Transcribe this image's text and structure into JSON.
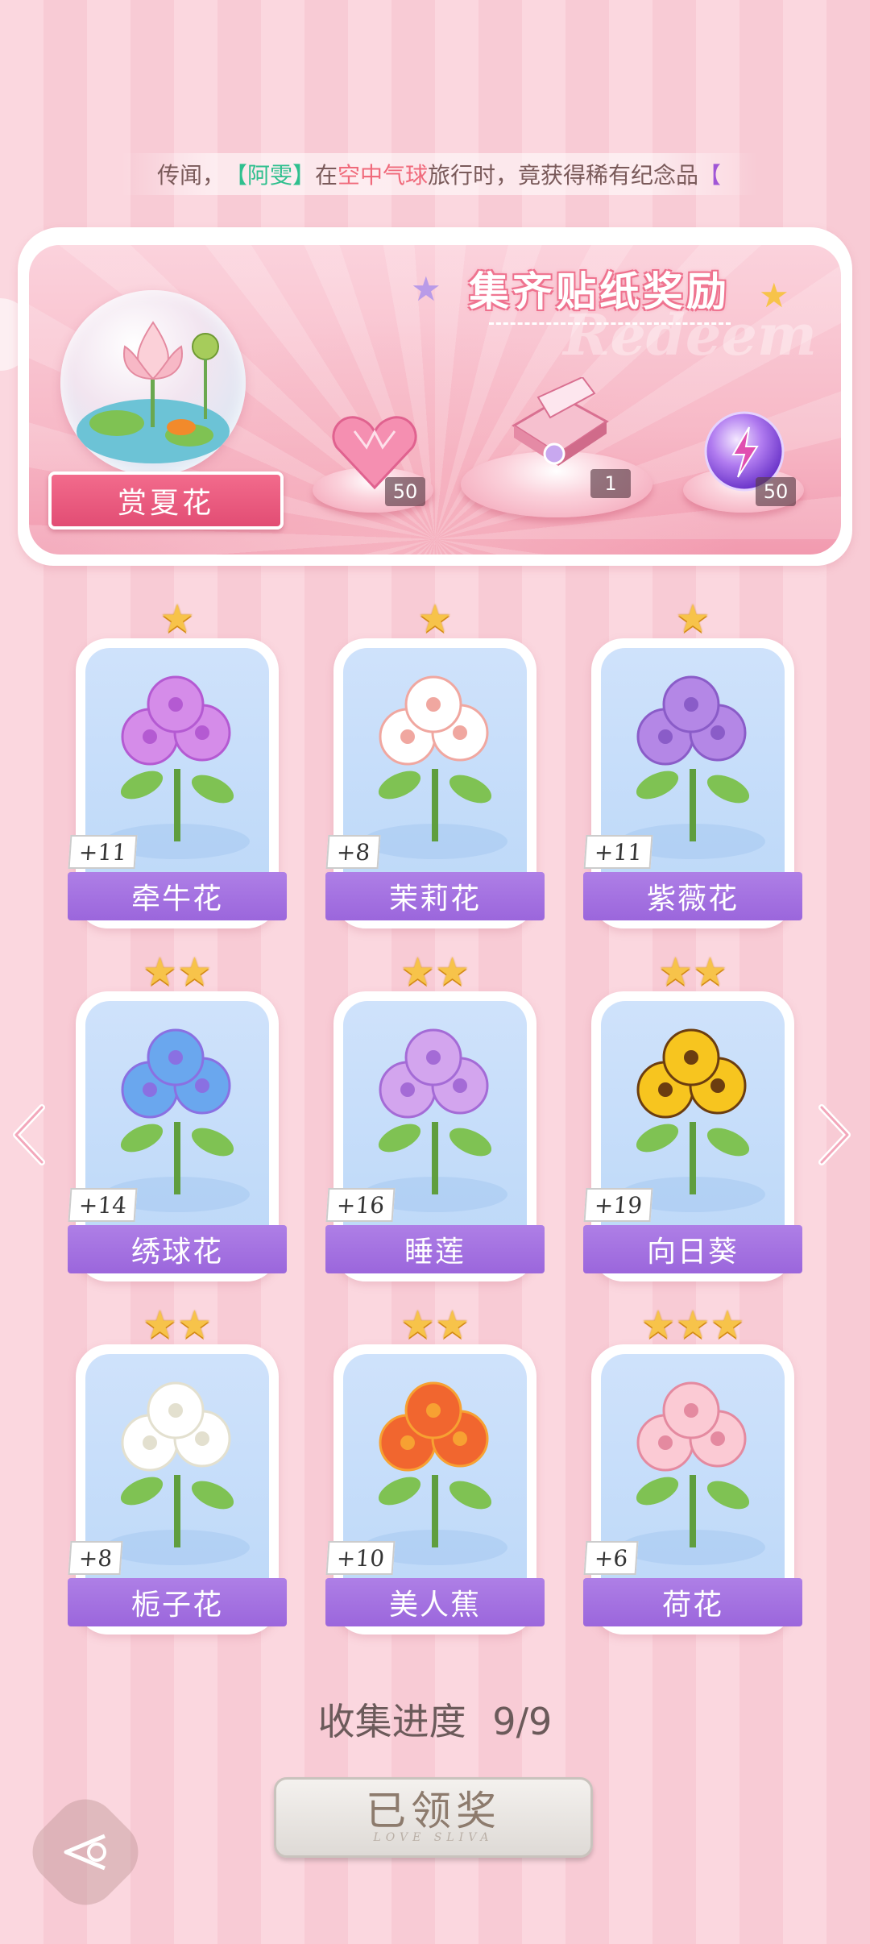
{
  "ticker": {
    "prefix": "传闻，",
    "name": "【阿雯】",
    "mid1": "在",
    "place": "空中气球",
    "mid2": "旅行时，竟获得稀有纪念品",
    "tail": "【"
  },
  "banner": {
    "title": "集齐贴纸奖励",
    "watermark": "Redeem",
    "main_reward_label": "赏夏花",
    "rewards": [
      {
        "icon": "pink-heart-gem-icon",
        "count": "50"
      },
      {
        "icon": "gift-box-icon",
        "count": "1"
      },
      {
        "icon": "energy-orb-icon",
        "count": "50"
      }
    ]
  },
  "cards": [
    {
      "name": "牵牛花",
      "bonus": "+11",
      "stars": 1,
      "icon": "morning-glory-icon"
    },
    {
      "name": "茉莉花",
      "bonus": "+8",
      "stars": 1,
      "icon": "jasmine-pot-icon"
    },
    {
      "name": "紫薇花",
      "bonus": "+11",
      "stars": 1,
      "icon": "crape-myrtle-icon"
    },
    {
      "name": "绣球花",
      "bonus": "+14",
      "stars": 2,
      "icon": "hydrangea-bouquet-icon"
    },
    {
      "name": "睡莲",
      "bonus": "+16",
      "stars": 2,
      "icon": "water-lily-icon"
    },
    {
      "name": "向日葵",
      "bonus": "+19",
      "stars": 2,
      "icon": "sunflower-bouquet-icon"
    },
    {
      "name": "栀子花",
      "bonus": "+8",
      "stars": 2,
      "icon": "gardenia-vase-icon"
    },
    {
      "name": "美人蕉",
      "bonus": "+10",
      "stars": 2,
      "icon": "canna-bouquet-icon"
    },
    {
      "name": "荷花",
      "bonus": "+6",
      "stars": 3,
      "icon": "lotus-pond-icon"
    }
  ],
  "progress": {
    "label": "收集进度",
    "value": "9/9"
  },
  "claim_button": {
    "label": "已领奖",
    "subtext": "LOVE SLIVA"
  },
  "colors": {
    "accent": "#9b66dc",
    "pink": "#e24d74",
    "star": "#f7c34a"
  }
}
